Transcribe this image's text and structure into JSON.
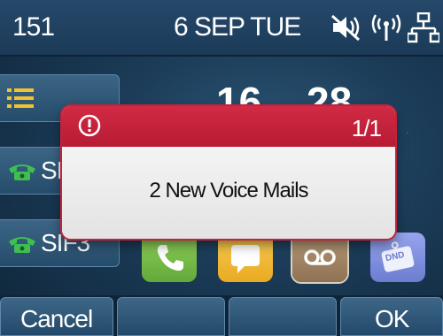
{
  "status_bar": {
    "account": "151",
    "date": "6 SEP TUE",
    "icons": [
      "mute-icon",
      "wireless-signal-icon",
      "network-icon"
    ]
  },
  "clock": {
    "hours": "16",
    "minutes": "28"
  },
  "line_keys": [
    {
      "icon": "menu-icon",
      "label": ""
    },
    {
      "icon": "phone-icon",
      "label": "SIF"
    },
    {
      "icon": "phone-icon",
      "label": "SIF3"
    }
  ],
  "apps": [
    {
      "icon": "phone-app-icon",
      "color": "#7dc04a"
    },
    {
      "icon": "message-app-icon",
      "color": "#f2be3c"
    },
    {
      "icon": "voicemail-app-icon",
      "color": "#a88b6a"
    },
    {
      "icon": "dnd-app-icon",
      "color": "#7f8fd8",
      "badge": "DND"
    }
  ],
  "popup": {
    "page": "1/1",
    "message": "2 New Voice Mails",
    "header_color": "#c82239"
  },
  "softkeys": {
    "cancel": "Cancel",
    "ok": "OK"
  }
}
